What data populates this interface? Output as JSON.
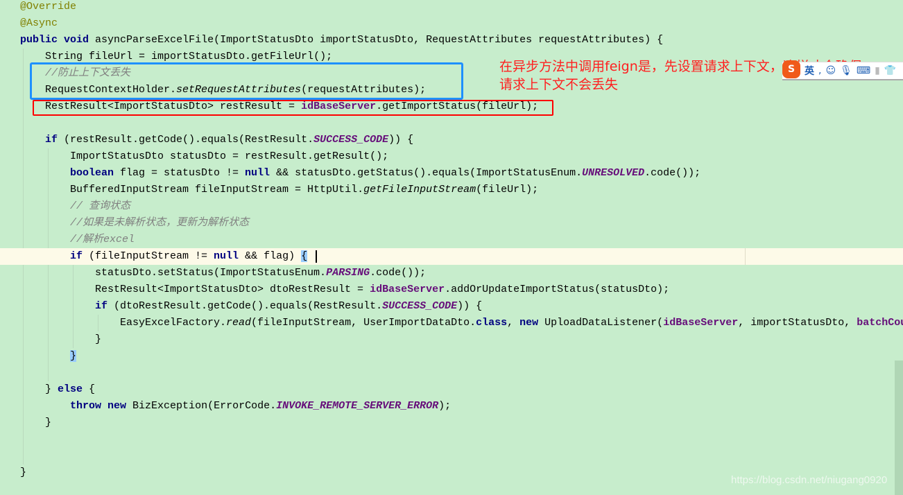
{
  "colors": {
    "background": "#c7edcc",
    "keyword": "#000080",
    "annotation": "#808000",
    "comment": "#808080",
    "field": "#660e7a",
    "note": "#ff2020",
    "blue_box": "#1e90ff",
    "red_box": "#ff0000"
  },
  "current_line": 15,
  "code_lines": [
    {
      "indent": 0,
      "tokens": [
        [
          "@Override",
          "ann"
        ]
      ]
    },
    {
      "indent": 0,
      "tokens": [
        [
          "@Async",
          "ann"
        ]
      ]
    },
    {
      "indent": 0,
      "tokens": [
        [
          "public",
          "kw"
        ],
        [
          " "
        ],
        [
          "void",
          "kw"
        ],
        [
          " asyncParseExcelFile(ImportStatusDto importStatusDto, RequestAttributes requestAttributes) {"
        ]
      ]
    },
    {
      "indent": 1,
      "tokens": [
        [
          "String fileUrl = importStatusDto.getFileUrl();"
        ]
      ]
    },
    {
      "indent": 1,
      "tokens": [
        [
          "//防止上下文丢失",
          "cm"
        ]
      ]
    },
    {
      "indent": 1,
      "tokens": [
        [
          "RequestContextHolder."
        ],
        [
          "setRequestAttributes",
          "st"
        ],
        [
          "(requestAttributes);"
        ]
      ]
    },
    {
      "indent": 1,
      "tokens": [
        [
          "RestResult<ImportStatusDto> restResult = "
        ],
        [
          "idBaseServer",
          "fld"
        ],
        [
          ".getImportStatus(fileUrl);"
        ]
      ]
    },
    {
      "indent": 0,
      "tokens": []
    },
    {
      "indent": 1,
      "tokens": [
        [
          "if",
          "kw"
        ],
        [
          " (restResult.getCode().equals(RestResult."
        ],
        [
          "SUCCESS_CODE",
          "const"
        ],
        [
          ")) {"
        ]
      ]
    },
    {
      "indent": 2,
      "tokens": [
        [
          "ImportStatusDto statusDto = restResult.getResult();"
        ]
      ]
    },
    {
      "indent": 2,
      "tokens": [
        [
          "boolean",
          "kw"
        ],
        [
          " flag = statusDto != "
        ],
        [
          "null",
          "kw"
        ],
        [
          " && statusDto.getStatus().equals(ImportStatusEnum."
        ],
        [
          "UNRESOLVED",
          "const"
        ],
        [
          ".code());"
        ]
      ]
    },
    {
      "indent": 2,
      "tokens": [
        [
          "BufferedInputStream fileInputStream = HttpUtil."
        ],
        [
          "getFileInputStream",
          "st"
        ],
        [
          "(fileUrl);"
        ]
      ]
    },
    {
      "indent": 2,
      "tokens": [
        [
          "// 查询状态",
          "cm"
        ]
      ]
    },
    {
      "indent": 2,
      "tokens": [
        [
          "//如果是未解析状态，更新为解析状态",
          "cm"
        ]
      ]
    },
    {
      "indent": 2,
      "tokens": [
        [
          "//解析excel",
          "cm"
        ]
      ]
    },
    {
      "indent": 2,
      "tokens": [
        [
          "if",
          "kw"
        ],
        [
          " (fileInputStream != "
        ],
        [
          "null",
          "kw"
        ],
        [
          " && flag) "
        ],
        [
          "{",
          "brace"
        ]
      ]
    },
    {
      "indent": 3,
      "tokens": [
        [
          "statusDto.setStatus(ImportStatusEnum."
        ],
        [
          "PARSING",
          "const"
        ],
        [
          ".code());"
        ]
      ]
    },
    {
      "indent": 3,
      "tokens": [
        [
          "RestResult<ImportStatusDto> dtoRestResult = "
        ],
        [
          "idBaseServer",
          "fld"
        ],
        [
          ".addOrUpdateImportStatus(statusDto);"
        ]
      ]
    },
    {
      "indent": 3,
      "tokens": [
        [
          "if",
          "kw"
        ],
        [
          " (dtoRestResult.getCode().equals(RestResult."
        ],
        [
          "SUCCESS_CODE",
          "const"
        ],
        [
          ")) {"
        ]
      ]
    },
    {
      "indent": 4,
      "tokens": [
        [
          "EasyExcelFactory."
        ],
        [
          "read",
          "st"
        ],
        [
          "(fileInputStream, UserImportDataDto."
        ],
        [
          "class",
          "kw"
        ],
        [
          ", "
        ],
        [
          "new",
          "kw"
        ],
        [
          " UploadDataListener("
        ],
        [
          "idBaseServer",
          "fld"
        ],
        [
          ", importStatusDto, "
        ],
        [
          "batchCou",
          "fld"
        ]
      ]
    },
    {
      "indent": 3,
      "tokens": [
        [
          "}"
        ]
      ]
    },
    {
      "indent": 2,
      "tokens": [
        [
          "}",
          "brace"
        ]
      ]
    },
    {
      "indent": 0,
      "tokens": []
    },
    {
      "indent": 1,
      "tokens": [
        [
          "} "
        ],
        [
          "else",
          "kw"
        ],
        [
          " {"
        ]
      ]
    },
    {
      "indent": 2,
      "tokens": [
        [
          "throw",
          "kw"
        ],
        [
          " "
        ],
        [
          "new",
          "kw"
        ],
        [
          " BizException(ErrorCode."
        ],
        [
          "INVOKE_REMOTE_SERVER_ERROR",
          "const"
        ],
        [
          ");"
        ]
      ]
    },
    {
      "indent": 1,
      "tokens": [
        [
          "}"
        ]
      ]
    },
    {
      "indent": 0,
      "tokens": []
    },
    {
      "indent": 0,
      "tokens": []
    },
    {
      "indent": 0,
      "tokens": [
        [
          "}"
        ]
      ]
    }
  ],
  "note": {
    "line1": "在异步方法中调用feign是，先设置请求上下文，这样才会确保",
    "line2": "请求上下文不会丢失"
  },
  "ime": {
    "lang": "英",
    "icons": [
      "sogou-logo-icon",
      "punctuation-icon",
      "emoji-icon",
      "microphone-icon",
      "keyboard-icon",
      "toolbox-icon",
      "skin-icon"
    ]
  },
  "watermark": "https://blog.csdn.net/niugang0920"
}
